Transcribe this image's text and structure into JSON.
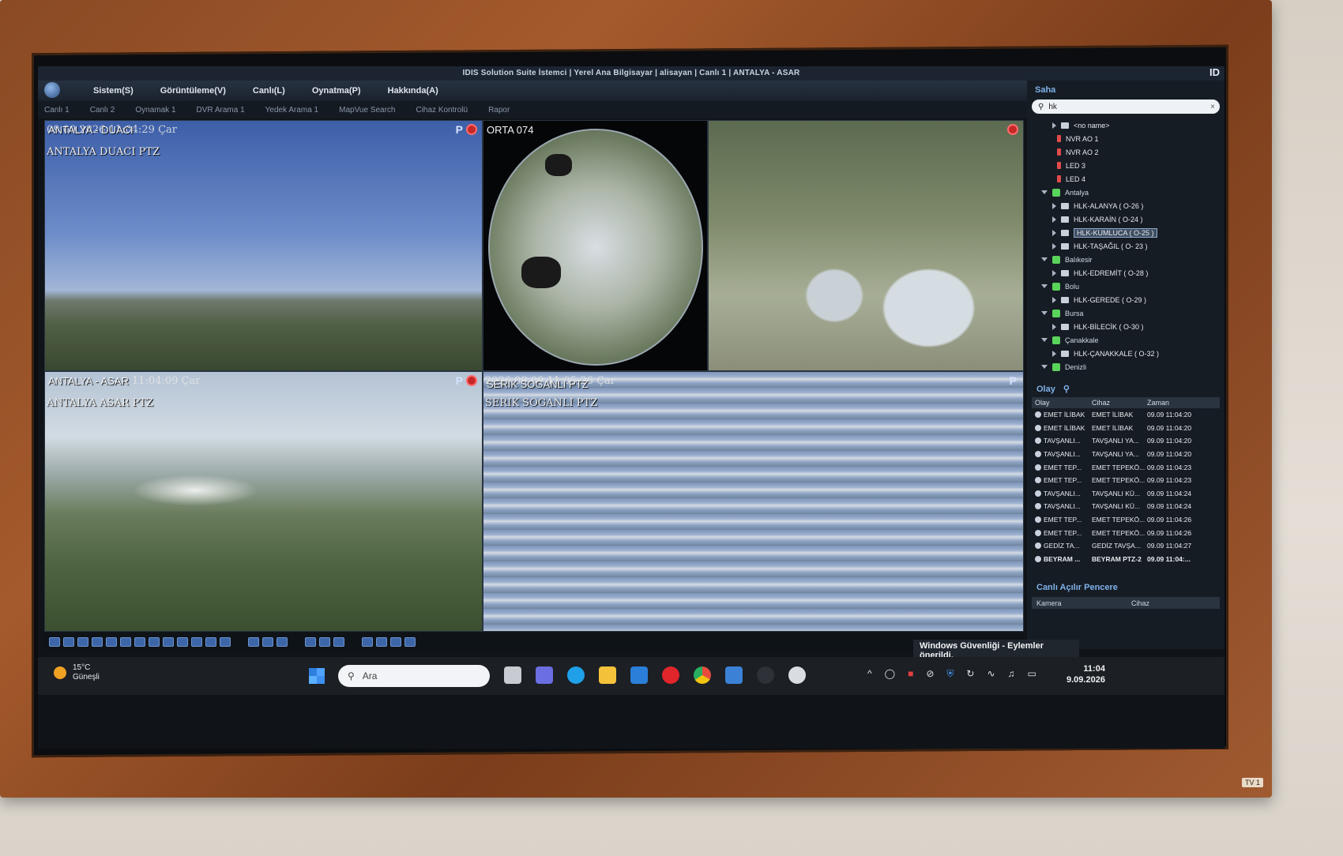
{
  "window": {
    "title": "IDIS Solution Suite İstemci | Yerel Ana Bilgisayar | alisayan | Canlı 1 | ANTALYA - ASAR",
    "brand": "ID"
  },
  "menu": [
    "Sistem(S)",
    "Görüntüleme(V)",
    "Canlı(L)",
    "Oynatma(P)",
    "Hakkında(A)"
  ],
  "tabs": [
    "Canlı 1",
    "Canlı 2",
    "Oynamak 1",
    "DVR Arama 1",
    "Yedek Arama 1",
    "MapVue Search",
    "Cihaz Kontrolü",
    "Rapor"
  ],
  "cameras": [
    {
      "title": "ANTALYA - DUACI",
      "stamp": "09.09.2026 11:04:29 Çar",
      "label": "ANTALYA DUACI PTZ",
      "badge": "P"
    },
    {
      "title": "ORTA 074"
    },
    {
      "title": ""
    },
    {
      "title": "ANTALYA - ASAR",
      "stamp": "11:04:09 Çar",
      "label": "ANTALYA ASAR PTZ",
      "badge": "P"
    },
    {
      "title": "SERIK SOGANLI PTZ",
      "stamp": "2026.09.09 11:05:26 Çar",
      "label": "SERIK SOGANLI PTZ",
      "badge": "P"
    }
  ],
  "panel": {
    "site_title": "Saha",
    "search_value": "hk",
    "tree": [
      {
        "label": "<no name>",
        "type": "device",
        "indent": 1
      },
      {
        "label": "NVR AO 1",
        "type": "led",
        "indent": 1
      },
      {
        "label": "NVR AO 2",
        "type": "led",
        "indent": 1
      },
      {
        "label": "LED 3",
        "type": "led",
        "indent": 1
      },
      {
        "label": "LED 4",
        "type": "led",
        "indent": 1
      },
      {
        "label": "Antalya",
        "type": "group",
        "indent": 0
      },
      {
        "label": "HLK-ALANYA ( O-26 )",
        "type": "device",
        "indent": 1
      },
      {
        "label": "HLK-KARAİN ( O-24 )",
        "type": "device",
        "indent": 1
      },
      {
        "label": "HLK-KUMLUCA ( O-25 )",
        "type": "device",
        "indent": 1,
        "selected": true
      },
      {
        "label": "HLK-TAŞAĞIL ( O- 23 )",
        "type": "device",
        "indent": 1
      },
      {
        "label": "Balıkesir",
        "type": "group",
        "indent": 0
      },
      {
        "label": "HLK-EDREMİT ( O-28 )",
        "type": "device",
        "indent": 1
      },
      {
        "label": "Bolu",
        "type": "group",
        "indent": 0
      },
      {
        "label": "HLK-GEREDE ( O-29 )",
        "type": "device",
        "indent": 1
      },
      {
        "label": "Bursa",
        "type": "group",
        "indent": 0
      },
      {
        "label": "HLK-BİLECİK ( O-30 )",
        "type": "device",
        "indent": 1
      },
      {
        "label": "Çanakkale",
        "type": "group",
        "indent": 0
      },
      {
        "label": "HLK-ÇANAKKALE ( O-32 )",
        "type": "device",
        "indent": 1
      },
      {
        "label": "Denizli",
        "type": "group",
        "indent": 0
      }
    ],
    "events_title": "Olay",
    "events_columns": [
      "Olay",
      "Cihaz",
      "Zaman"
    ],
    "events": [
      [
        "EMET İLİBAK",
        "EMET İLİBAK",
        "09.09 11:04:20"
      ],
      [
        "EMET İLİBAK",
        "EMET İLİBAK",
        "09.09 11:04:20"
      ],
      [
        "TAVŞANLI...",
        "TAVŞANLI YA...",
        "09.09 11:04:20"
      ],
      [
        "TAVŞANLI...",
        "TAVŞANLI YA...",
        "09.09 11:04:20"
      ],
      [
        "EMET TEP...",
        "EMET TEPEKÖ...",
        "09.09 11:04:23"
      ],
      [
        "EMET TEP...",
        "EMET TEPEKÖ...",
        "09.09 11:04:23"
      ],
      [
        "TAVŞANLI...",
        "TAVŞANLI KÜ...",
        "09.09 11:04:24"
      ],
      [
        "TAVŞANLI...",
        "TAVŞANLI KÜ...",
        "09.09 11:04:24"
      ],
      [
        "EMET TEP...",
        "EMET TEPEKÖ...",
        "09.09 11:04:26"
      ],
      [
        "EMET TEP...",
        "EMET TEPEKÖ...",
        "09.09 11:04:26"
      ],
      [
        "GEDİZ TA...",
        "GEDİZ TAVŞA...",
        "09.09 11:04:27"
      ],
      [
        "BEYRAM ...",
        "BEYRAM PTZ-2",
        "09.09 11:04:..."
      ]
    ],
    "popup_title": "Canlı Açılır Pencere",
    "popup_columns": [
      "Kamera",
      "Cihaz"
    ]
  },
  "notification": "Windows Güvenliği - Eylemler önerildi.",
  "taskbar": {
    "weather_temp": "15°C",
    "weather_desc": "Güneşli",
    "search_placeholder": "Ara",
    "time": "11:04",
    "date": "9.09.2026"
  },
  "frame_tag": "TV 1"
}
